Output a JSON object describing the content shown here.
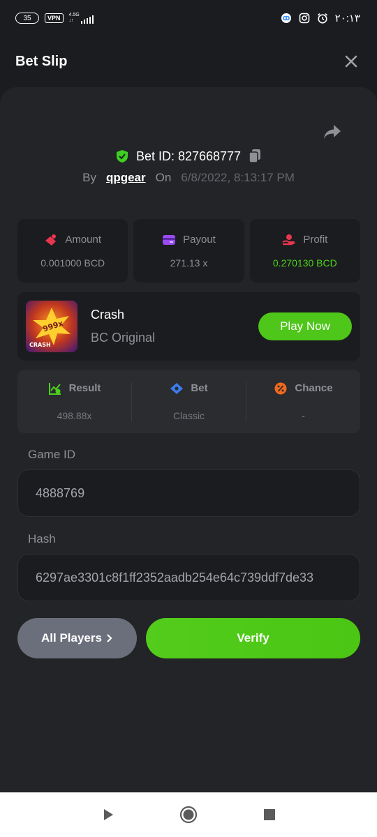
{
  "status_bar": {
    "battery": "35",
    "vpn": "VPN",
    "network_top": "4.5G",
    "network_bottom": "↓↑",
    "time": "۲۰:۱۳",
    "icons": [
      "link-icon",
      "instagram-icon",
      "alarm-icon"
    ]
  },
  "header": {
    "title": "Bet Slip",
    "close_icon": "close-icon"
  },
  "bet": {
    "id_label": "Bet ID: 827668777",
    "by_label": "By",
    "user": "qpgear",
    "on_label": "On",
    "date": "6/8/2022, 8:13:17 PM"
  },
  "stats": [
    {
      "label": "Amount",
      "value": "0.001000 BCD",
      "icon": "coins-icon",
      "color": "#e8364f"
    },
    {
      "label": "Payout",
      "value": "271.13 x",
      "icon": "wallet-icon",
      "color": "#9a4bf0"
    },
    {
      "label": "Profit",
      "value": "0.270130 BCD",
      "icon": "hand-coin-icon",
      "color": "#e8364f"
    }
  ],
  "game": {
    "name": "Crash",
    "provider": "BC Original",
    "thumb_multiplier": "999x",
    "thumb_label": "CRASH",
    "play_label": "Play Now"
  },
  "result": [
    {
      "label": "Result",
      "value": "498.88x",
      "icon": "chart-check-icon",
      "color": "#4bd31a"
    },
    {
      "label": "Bet",
      "value": "Classic",
      "icon": "ticket-icon",
      "color": "#3d7cf0"
    },
    {
      "label": "Chance",
      "value": "-",
      "icon": "percent-icon",
      "color": "#f06a1e"
    }
  ],
  "fields": {
    "game_id_label": "Game ID",
    "game_id_value": "4888769",
    "hash_label": "Hash",
    "hash_value": "6297ae3301c8f1ff2352aadb254e64c739ddf7de33"
  },
  "buttons": {
    "all_players": "All Players",
    "verify": "Verify"
  },
  "colors": {
    "background": "#1b1c1f",
    "card": "#232427",
    "accent_green": "#4ec61a",
    "muted": "#8e9096"
  }
}
